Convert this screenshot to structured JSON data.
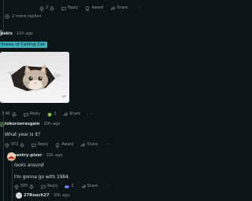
{
  "top_comment_actions": {
    "vote_count": "3",
    "reply": "Reply",
    "award": "Award",
    "share": "Share"
  },
  "more_replies": "2 more replies",
  "comment_catlord": {
    "username": "sakis",
    "age": "10h ago",
    "highlight": "ltness of Ceiling Cat",
    "gif_label": "GIF",
    "actions": {
      "vote_count": "7.4K",
      "reply": "Reply",
      "award_count": "3",
      "share": "Share"
    }
  },
  "comment_tokoro": {
    "username": "tokoroerasgain",
    "age": "10h ago",
    "body": "What year is it?",
    "actions": {
      "vote_count": "972",
      "reply": "Reply",
      "award": "Award",
      "share": "Share"
    }
  },
  "comment_pantry": {
    "username": "pantry-pixer",
    "age": "10h ago",
    "line1": "looks around",
    "line2": "I'm gonna go with 1984.",
    "actions": {
      "vote_count": "585",
      "reply": "Reply",
      "award_count": "2",
      "share": "Share"
    }
  },
  "comment_next": {
    "username": "27Rouch27",
    "age": "10h ago"
  },
  "colors": {
    "background": "#0b1416",
    "highlight": "#3fb0b7",
    "muted": "#8d9496",
    "award": "#f0a830",
    "award_blue": "#4fb5ff"
  }
}
